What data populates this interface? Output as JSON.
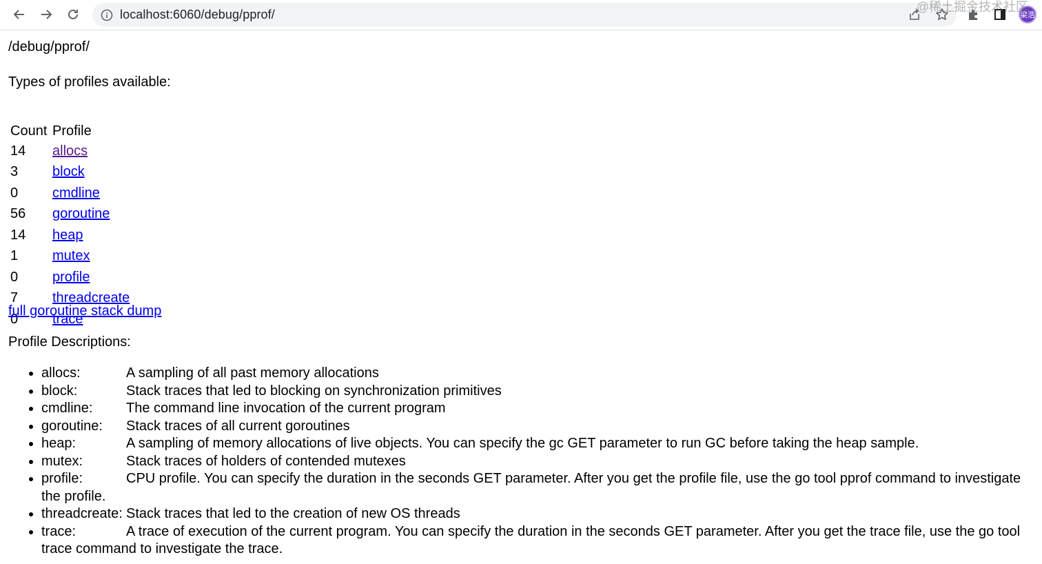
{
  "browser": {
    "url": "localhost:6060/debug/pprof/",
    "avatar_text": "梁浩"
  },
  "page": {
    "path": "/debug/pprof/",
    "types_label": "Types of profiles available:",
    "table_headers": [
      "Count",
      "Profile"
    ],
    "profiles": [
      {
        "count": "14",
        "name": "allocs"
      },
      {
        "count": "3",
        "name": "block"
      },
      {
        "count": "0",
        "name": "cmdline"
      },
      {
        "count": "56",
        "name": "goroutine"
      },
      {
        "count": "14",
        "name": "heap"
      },
      {
        "count": "1",
        "name": "mutex"
      },
      {
        "count": "0",
        "name": "profile"
      },
      {
        "count": "7",
        "name": "threadcreate"
      },
      {
        "count": "0",
        "name": "trace"
      }
    ],
    "full_dump_link": "full goroutine stack dump",
    "descriptions_label": "Profile Descriptions:",
    "descriptions": [
      {
        "term": "allocs:",
        "text": "A sampling of all past memory allocations"
      },
      {
        "term": "block:",
        "text": "Stack traces that led to blocking on synchronization primitives"
      },
      {
        "term": "cmdline:",
        "text": "The command line invocation of the current program"
      },
      {
        "term": "goroutine:",
        "text": "Stack traces of all current goroutines"
      },
      {
        "term": "heap:",
        "text": "A sampling of memory allocations of live objects. You can specify the gc GET parameter to run GC before taking the heap sample."
      },
      {
        "term": "mutex:",
        "text": "Stack traces of holders of contended mutexes"
      },
      {
        "term": "profile:",
        "text": "CPU profile. You can specify the duration in the seconds GET parameter. After you get the profile file, use the go tool pprof command to investigate the profile."
      },
      {
        "term": "threadcreate:",
        "text": "Stack traces that led to the creation of new OS threads"
      },
      {
        "term": "trace:",
        "text": "A trace of execution of the current program. You can specify the duration in the seconds GET parameter. After you get the trace file, use the go tool trace command to investigate the trace."
      }
    ],
    "watermark": "@稀土掘金技术社区"
  },
  "colors": {
    "link": "#0000ee",
    "visited_link": "#551a8b",
    "avatar_bg": "#6a3ec0"
  }
}
